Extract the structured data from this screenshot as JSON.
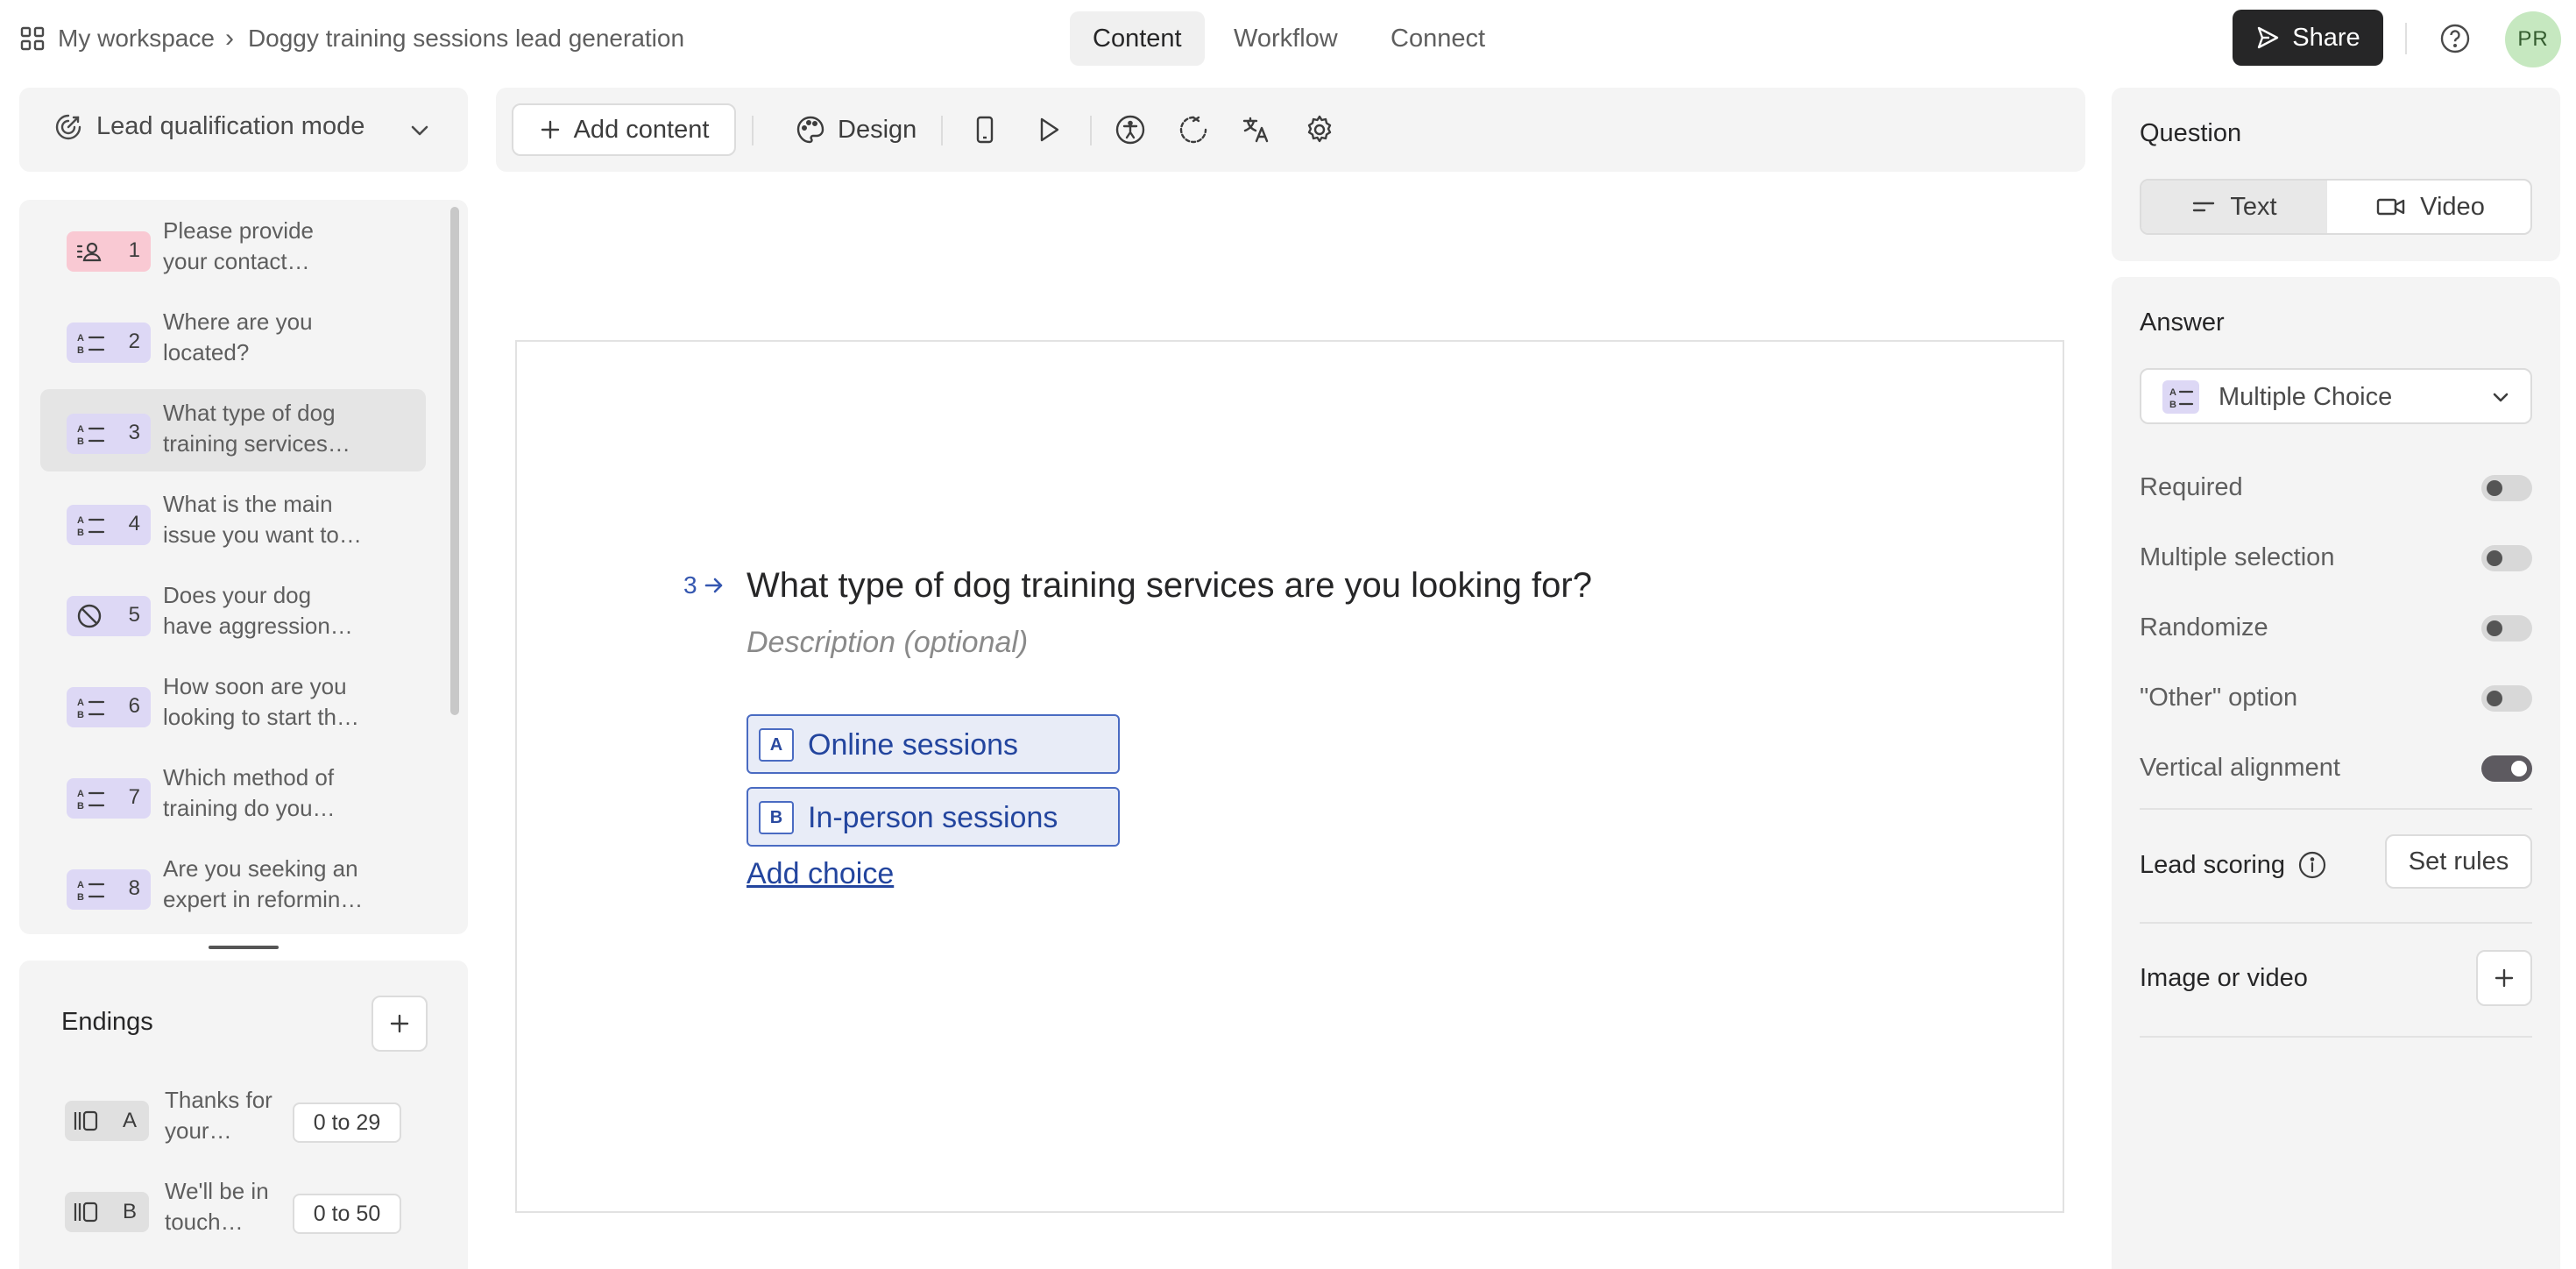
{
  "header": {
    "workspace": "My workspace",
    "separator": "›",
    "form_title": "Doggy training sessions lead generation",
    "tabs": [
      {
        "label": "Content",
        "active": true
      },
      {
        "label": "Workflow",
        "active": false
      },
      {
        "label": "Connect",
        "active": false
      }
    ],
    "share_label": "Share",
    "avatar_initials": "PR"
  },
  "sidebar": {
    "mode_label": "Lead qualification mode",
    "questions": [
      {
        "num": "1",
        "line1": "Please provide",
        "line2": "your contact…",
        "icon": "contact-info-icon",
        "color": "#f9c9d3",
        "selected": false
      },
      {
        "num": "2",
        "line1": "Where are you",
        "line2": "located?",
        "icon": "multiple-choice-icon",
        "color": "#ddd8f5",
        "selected": false
      },
      {
        "num": "3",
        "line1": "What type of dog",
        "line2": "training services…",
        "icon": "multiple-choice-icon",
        "color": "#ddd8f5",
        "selected": true
      },
      {
        "num": "4",
        "line1": "What is the main",
        "line2": "issue you want to…",
        "icon": "multiple-choice-icon",
        "color": "#ddd8f5",
        "selected": false
      },
      {
        "num": "5",
        "line1": "Does your dog",
        "line2": "have aggression…",
        "icon": "yes-no-icon",
        "color": "#ddd8f5",
        "selected": false
      },
      {
        "num": "6",
        "line1": "How soon are you",
        "line2": "looking to start th…",
        "icon": "multiple-choice-icon",
        "color": "#ddd8f5",
        "selected": false
      },
      {
        "num": "7",
        "line1": "Which method of",
        "line2": "training do you…",
        "icon": "multiple-choice-icon",
        "color": "#ddd8f5",
        "selected": false
      },
      {
        "num": "8",
        "line1": "Are you seeking an",
        "line2": "expert in reformin…",
        "icon": "multiple-choice-icon",
        "color": "#ddd8f5",
        "selected": false
      }
    ],
    "endings_title": "Endings",
    "endings": [
      {
        "letter": "A",
        "line1": "Thanks for",
        "line2": "your…",
        "range": "0 to 29"
      },
      {
        "letter": "B",
        "line1": "We'll be in",
        "line2": "touch…",
        "range": "0 to 50"
      }
    ]
  },
  "toolbar": {
    "add_content_label": "Add content",
    "design_label": "Design"
  },
  "canvas": {
    "question_number": "3",
    "question_title": "What type of dog training services are you looking for?",
    "description_placeholder": "Description (optional)",
    "choices": [
      {
        "key": "A",
        "label": "Online sessions"
      },
      {
        "key": "B",
        "label": "In-person sessions"
      }
    ],
    "add_choice_label": "Add choice"
  },
  "panel": {
    "question_heading": "Question",
    "question_types": [
      {
        "label": "Text",
        "selected": true
      },
      {
        "label": "Video",
        "selected": false
      }
    ],
    "answer_heading": "Answer",
    "answer_type": "Multiple Choice",
    "settings": [
      {
        "label": "Required",
        "on": false
      },
      {
        "label": "Multiple selection",
        "on": false
      },
      {
        "label": "Randomize",
        "on": false
      },
      {
        "label": "\"Other\" option",
        "on": false
      },
      {
        "label": "Vertical alignment",
        "on": true
      }
    ],
    "lead_scoring_label": "Lead scoring",
    "set_rules_label": "Set rules",
    "image_video_label": "Image or video"
  }
}
